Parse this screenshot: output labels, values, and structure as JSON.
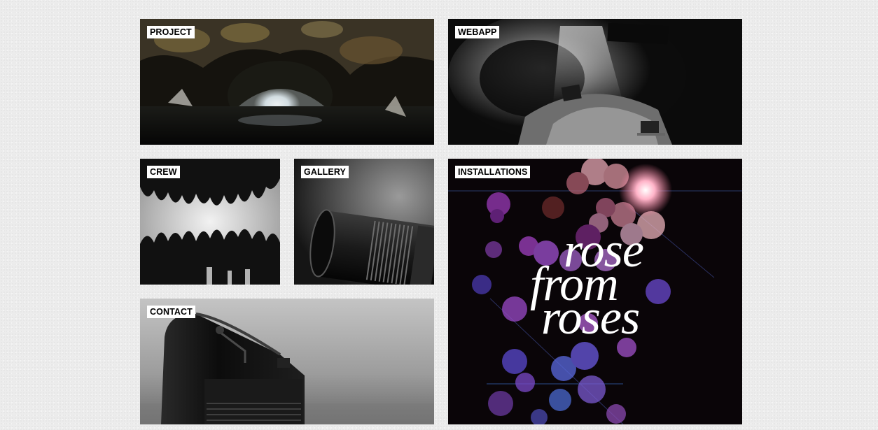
{
  "tiles": {
    "project": {
      "label": "PROJECT"
    },
    "webapp": {
      "label": "WEBAPP"
    },
    "crew": {
      "label": "CREW"
    },
    "gallery": {
      "label": "GALLERY"
    },
    "contact": {
      "label": "CONTACT"
    },
    "installations": {
      "label": "INSTALLATIONS",
      "art_title": [
        "rose",
        "from",
        "roses"
      ]
    }
  },
  "colors": {
    "page_background": "#ececec",
    "label_background": "#ffffff",
    "label_text": "#000000",
    "installation_background": "#0a0508",
    "bokeh_pink": "#ff9fb0",
    "bokeh_purple": "#8a3ad0",
    "bokeh_blue": "#5a5ce0"
  },
  "icons": {
    "project": "cave-image",
    "webapp": "cave-screens-image",
    "crew": "hands-image",
    "gallery": "camera-lens-image",
    "contact": "mailbox-image",
    "installations": "bokeh-poster-image"
  }
}
